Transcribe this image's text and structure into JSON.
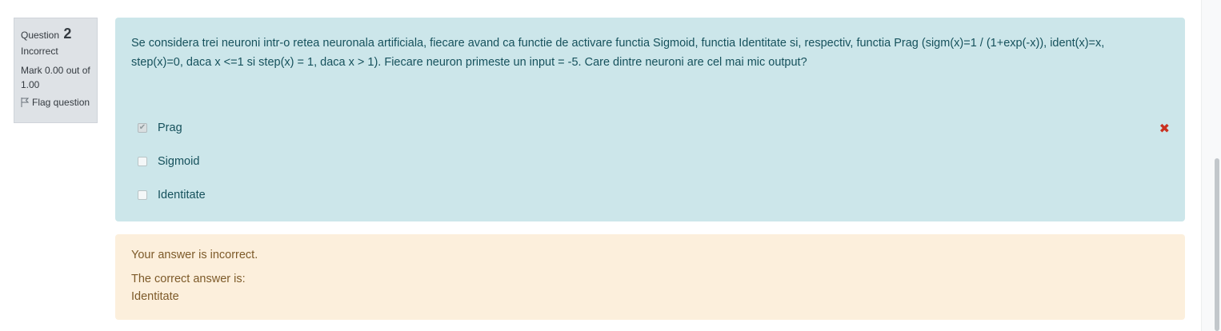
{
  "info": {
    "question_label": "Question",
    "question_number": "2",
    "state": "Incorrect",
    "grade": "Mark 0.00 out of 1.00",
    "flag_label": "Flag question"
  },
  "question": {
    "text": "Se considera trei neuroni intr-o retea neuronala artificiala, fiecare avand ca functie de activare functia Sigmoid, functia Identitate si, respectiv, functia Prag (sigm(x)=1 / (1+exp(-x)), ident(x)=x, step(x)=0, daca x <=1 si step(x) = 1, daca x > 1). Fiecare neuron primeste un input = -5. Care dintre neuroni are cel mai mic output?",
    "answers": [
      {
        "label": "Prag",
        "checked": true,
        "incorrect_mark": "✖"
      },
      {
        "label": "Sigmoid",
        "checked": false
      },
      {
        "label": "Identitate",
        "checked": false
      }
    ]
  },
  "outcome": {
    "feedback": "Your answer is incorrect.",
    "right_answer_label": "The correct answer is:",
    "right_answer_value": "Identitate"
  },
  "colors": {
    "formulation_bg": "#cce6ea",
    "outcome_bg": "#fcefdc",
    "incorrect": "#ca3120"
  }
}
